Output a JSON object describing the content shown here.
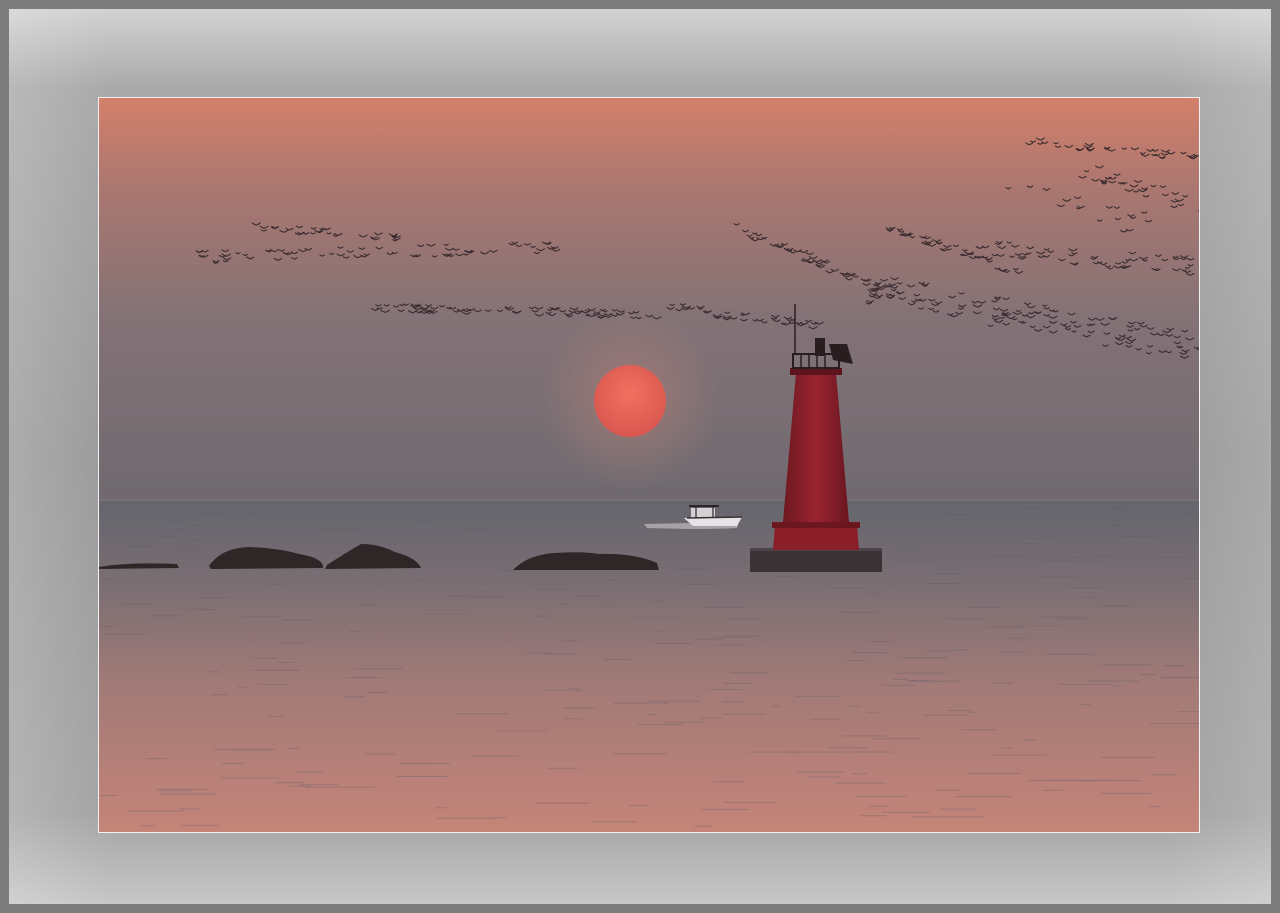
{
  "image": {
    "subject": "lighthouse",
    "colors": {
      "sky_top": "#d4806a",
      "sky_mid": "#8c7474",
      "sky_horizon": "#6f6a70",
      "sea": "#6e6a70",
      "sea_glow": "#c58478",
      "sun": "#e9675a",
      "lighthouse": "#8e1f2a",
      "frame": "#9a9a9a"
    }
  }
}
